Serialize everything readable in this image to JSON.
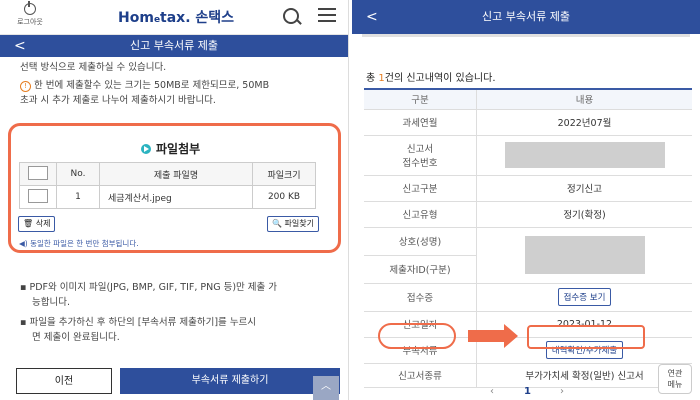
{
  "left": {
    "logout_label": "로그아웃",
    "logo_left": "Hom",
    "logo_e": "e",
    "logo_right": "tax. 손택스",
    "nav_back": "<",
    "nav_title": "신고 부속서류 제출",
    "line1": "선택 방식으로 제출하실 수 있습니다.",
    "line2": "한 번에 제출할수 있는 크기는 50MB로 제한되므로, 50MB",
    "line3": "초과 시 추가 제출로 나누어 제출하시기 바랍니다.",
    "attach_title": "파일첨부",
    "table": {
      "headers": [
        "No.",
        "제출 파일명",
        "파일크기"
      ],
      "rows": [
        {
          "no": "1",
          "name": "세금계산서.jpeg",
          "size": "200 KB"
        }
      ]
    },
    "delete_label": "삭제",
    "find_label": "파일찾기",
    "hint": "동일한 파일은 한 번만 첨부됩니다.",
    "bullet1a": "PDF와 이미지 파일(JPG, BMP, GIF, TIF, PNG 등)만 제출 가",
    "bullet1b": "능합니다.",
    "bullet2a": "파일을 추가하신 후 하단의 [부속서류 제출하기]를 누르시",
    "bullet2b": "면 제출이 완료됩니다.",
    "prev_label": "이전",
    "submit_label": "부속서류 제출하기",
    "scroll_top_label": "︿"
  },
  "right": {
    "nav_back": "<",
    "nav_title": "신고 부속서류 제출",
    "count_prefix": "총 ",
    "count_num": "1",
    "count_suffix": "건의 신고내역이 있습니다.",
    "head_col1": "구분",
    "head_col2": "내용",
    "row_tax_period_k": "과세연월",
    "row_tax_period_v": "2022년07월",
    "row_receipt_no_k1": "신고서",
    "row_receipt_no_k2": "접수번호",
    "row_type_k": "신고구분",
    "row_type_v": "정기신고",
    "row_kind_k": "신고유형",
    "row_kind_v": "정기(확정)",
    "row_name_k": "상호(성명)",
    "row_id_k": "제출자ID(구분)",
    "row_cert_k": "접수증",
    "row_cert_btn": "접수증 보기",
    "row_date_k": "신고일자",
    "row_date_v": "2023-01-12",
    "row_attach_k": "부속서류",
    "row_attach_btn": "내역확인/추가제출",
    "row_form_k": "신고서종류",
    "row_form_v": "부가가치세 확정(일반) 신고서",
    "pager_prev": "‹",
    "pager_page": "1",
    "pager_next": "›",
    "corner_line1": "연관",
    "corner_line2": "메뉴"
  }
}
